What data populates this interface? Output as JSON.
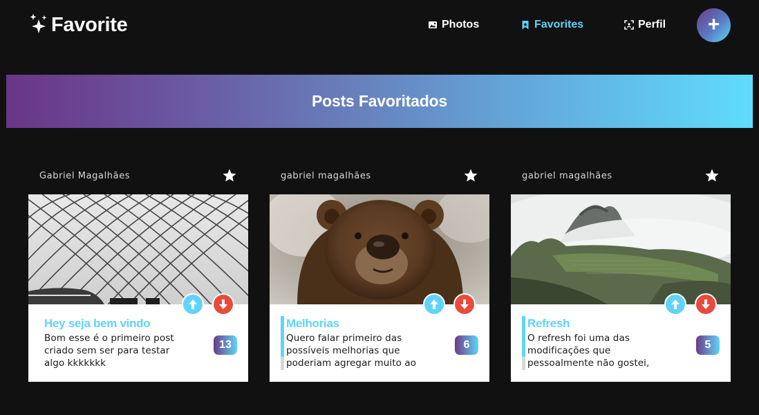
{
  "header": {
    "logo_text": "Favorite",
    "logo_icon": "sparkles-icon",
    "nav": [
      {
        "label": "Photos",
        "icon": "image-icon",
        "active": false
      },
      {
        "label": "Favorites",
        "icon": "bookmark-icon",
        "active": true
      },
      {
        "label": "Perfil",
        "icon": "profile-scan-icon",
        "active": false
      }
    ],
    "add_button_label": "+"
  },
  "banner": {
    "title": "Posts Favoritados"
  },
  "colors": {
    "background": "#111111",
    "accent": "#5fd4f8",
    "upvote": "#5fd4f8",
    "downvote": "#e84b3c",
    "gradient_start": "#6a3587",
    "gradient_end": "#5fdcfb"
  },
  "posts": [
    {
      "author": "Gabriel Magalhães",
      "favorited": true,
      "image": "glass-dome-roof",
      "title": "Hey seja bem vindo",
      "description": "Bom esse é o primeiro post criado sem ser para testar algo kkkkkkk",
      "count": "13"
    },
    {
      "author": "gabriel magalhães",
      "favorited": true,
      "image": "brown-bear",
      "title": "Melhorias",
      "description": "Quero falar primeiro das possíveis melhorias que poderiam agregar muito ao site",
      "count": "6"
    },
    {
      "author": "gabriel magalhães",
      "favorited": true,
      "image": "machu-picchu-mountains",
      "title": "Refresh",
      "description": "O refresh foi uma das modificações que pessoalmente não gostei, além de parecer um bug",
      "count": "5"
    }
  ]
}
